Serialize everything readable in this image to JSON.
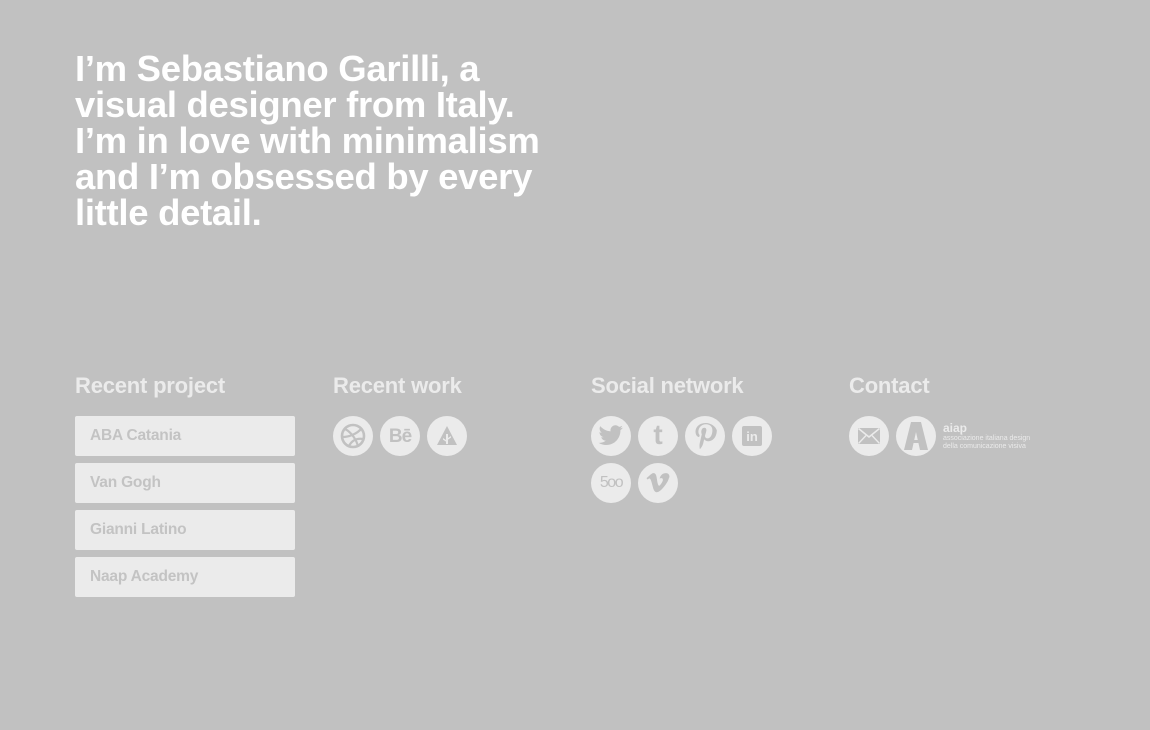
{
  "intro": {
    "line1": "I’m Sebastiano Garilli, a visual designer from Italy.",
    "line2": "I’m in love with minimalism and I’m obsessed by every little detail."
  },
  "projects": {
    "heading": "Recent project",
    "items": [
      "ABA Catania",
      "Van Gogh",
      "Gianni Latino",
      "Naap Academy"
    ]
  },
  "work": {
    "heading": "Recent work",
    "icons": [
      "dribbble-icon",
      "behance-icon",
      "forrst-icon"
    ],
    "behance_glyph": "Bē"
  },
  "social": {
    "heading": "Social network",
    "icons": [
      "twitter-icon",
      "tumblr-icon",
      "pinterest-icon",
      "linkedin-icon",
      "500px-icon",
      "vimeo-icon"
    ],
    "tumblr_glyph": "t",
    "linkedin_glyph": "in",
    "fivehundred_glyph": "5oo",
    "vimeo_glyph": "v"
  },
  "contact": {
    "heading": "Contact",
    "icons": [
      "mail-icon",
      "aiap-logo-icon"
    ],
    "aiap_name": "aiap",
    "aiap_line1": "associazione italiana design",
    "aiap_line2": "della comunicazione visiva"
  },
  "colors": {
    "background": "#c1c1c1",
    "primary_text": "#ffffff",
    "heading_text": "#ebebeb",
    "button_bg": "#ebebeb",
    "button_text": "#c3c3c3"
  }
}
